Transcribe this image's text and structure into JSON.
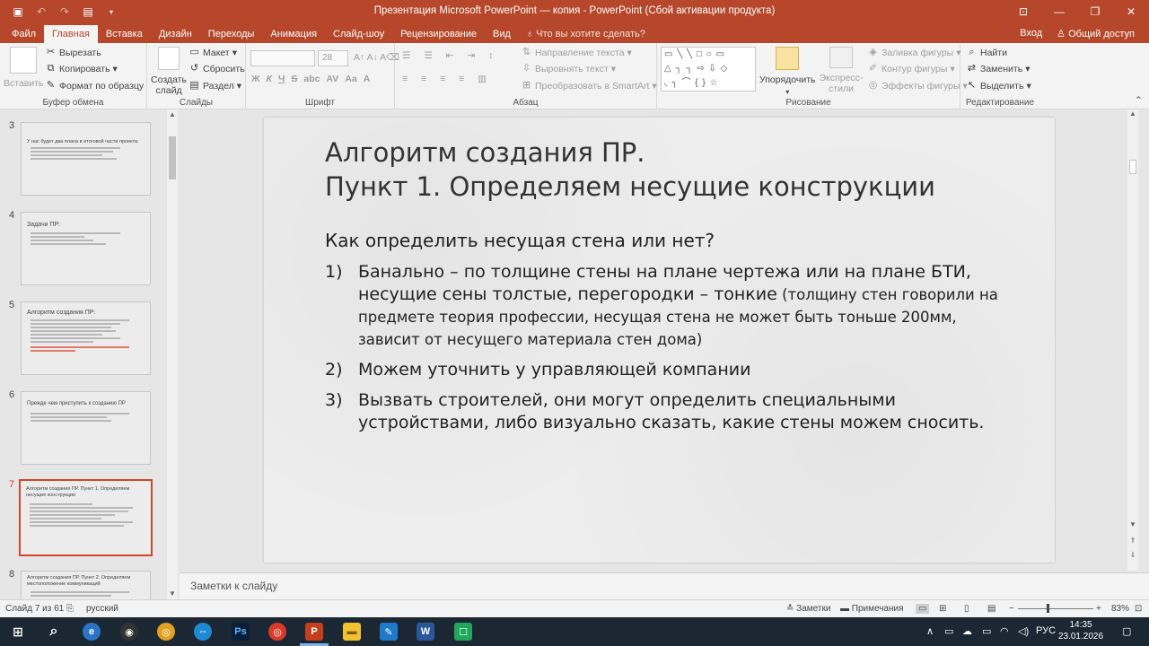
{
  "window": {
    "title": "Презентация Microsoft PowerPoint — копия - PowerPoint (Сбой активации продукта)",
    "accent": "#b7472a"
  },
  "ribbon_tabs": [
    "Файл",
    "Главная",
    "Вставка",
    "Дизайн",
    "Переходы",
    "Анимация",
    "Слайд-шоу",
    "Рецензирование",
    "Вид"
  ],
  "active_tab": "Главная",
  "tell_me": "Что вы хотите сделать?",
  "sign_in": "Вход",
  "share": "Общий доступ",
  "ribbon": {
    "clipboard": {
      "paste": "Вставить",
      "cut": "Вырезать",
      "copy": "Копировать",
      "format_painter": "Формат по образцу",
      "label": "Буфер обмена"
    },
    "slides": {
      "new_slide": "Создать слайд",
      "layout": "Макет",
      "reset": "Сбросить",
      "section": "Раздел",
      "label": "Слайды"
    },
    "font": {
      "size": "28",
      "bold": "Ж",
      "italic": "К",
      "underline": "Ч",
      "strike": "S",
      "shadow": "abc",
      "spacing": "AV",
      "case": "Aa",
      "color": "A",
      "label": "Шрифт"
    },
    "paragraph": {
      "text_direction": "Направление текста",
      "align_text": "Выровнять текст",
      "smartart": "Преобразовать в SmartArt",
      "label": "Абзац"
    },
    "drawing": {
      "arrange": "Упорядочить",
      "quick_styles": "Экспресс-стили",
      "fill": "Заливка фигуры",
      "outline": "Контур фигуры",
      "effects": "Эффекты фигуры",
      "label": "Рисование"
    },
    "editing": {
      "find": "Найти",
      "replace": "Заменить",
      "select": "Выделить",
      "label": "Редактирование"
    }
  },
  "thumbnails": [
    {
      "num": "3",
      "title": "У нас будет два плана в итоговой части проекта:",
      "lines": 3,
      "red": false
    },
    {
      "num": "4",
      "title": "Задачи ПР:",
      "lines": 4,
      "red": false
    },
    {
      "num": "5",
      "title": "Алгоритм создания ПР:",
      "lines": 7,
      "red": true
    },
    {
      "num": "6",
      "title": "Прежде чем приступить к созданию ПР",
      "lines": 3,
      "red": false
    },
    {
      "num": "7",
      "title": "Алгоритм создания ПР. Пункт 1. Определяем несущие конструкции",
      "lines": 6,
      "red": false
    },
    {
      "num": "8",
      "title": "Алгоритм создания ПР. Пункт 2. Определяем местоположение коммуникаций",
      "lines": 2,
      "red": false
    }
  ],
  "selected_thumbnail": "7",
  "slide": {
    "title_line1": "Алгоритм создания ПР.",
    "title_line2": "Пункт 1. Определяем несущие конструкции",
    "subtitle": "Как определить несущая стена или нет?",
    "items": [
      {
        "num": "1)",
        "main": "Банально – по толщине стены на плане чертежа или на плане БТИ, несущие сены толстые, перегородки – тонкие",
        "note": " (толщину стен говорили на предмете теория профессии, несущая стена не может быть тоньше 200мм, зависит от несущего материала стен дома)"
      },
      {
        "num": "2)",
        "main": "Можем уточнить у управляющей компании",
        "note": ""
      },
      {
        "num": "3)",
        "main": "Вызвать строителей, они могут определить специальными устройствами, либо визуально сказать, какие стены можем сносить.",
        "note": ""
      }
    ]
  },
  "notes_placeholder": "Заметки к слайду",
  "status": {
    "slide_info": "Слайд 7 из 61",
    "language": "русский",
    "notes": "Заметки",
    "comments": "Примечания",
    "zoom": "83%"
  },
  "taskbar": {
    "lang": "РУС",
    "time": "14:35",
    "date": "23.01.2026"
  }
}
